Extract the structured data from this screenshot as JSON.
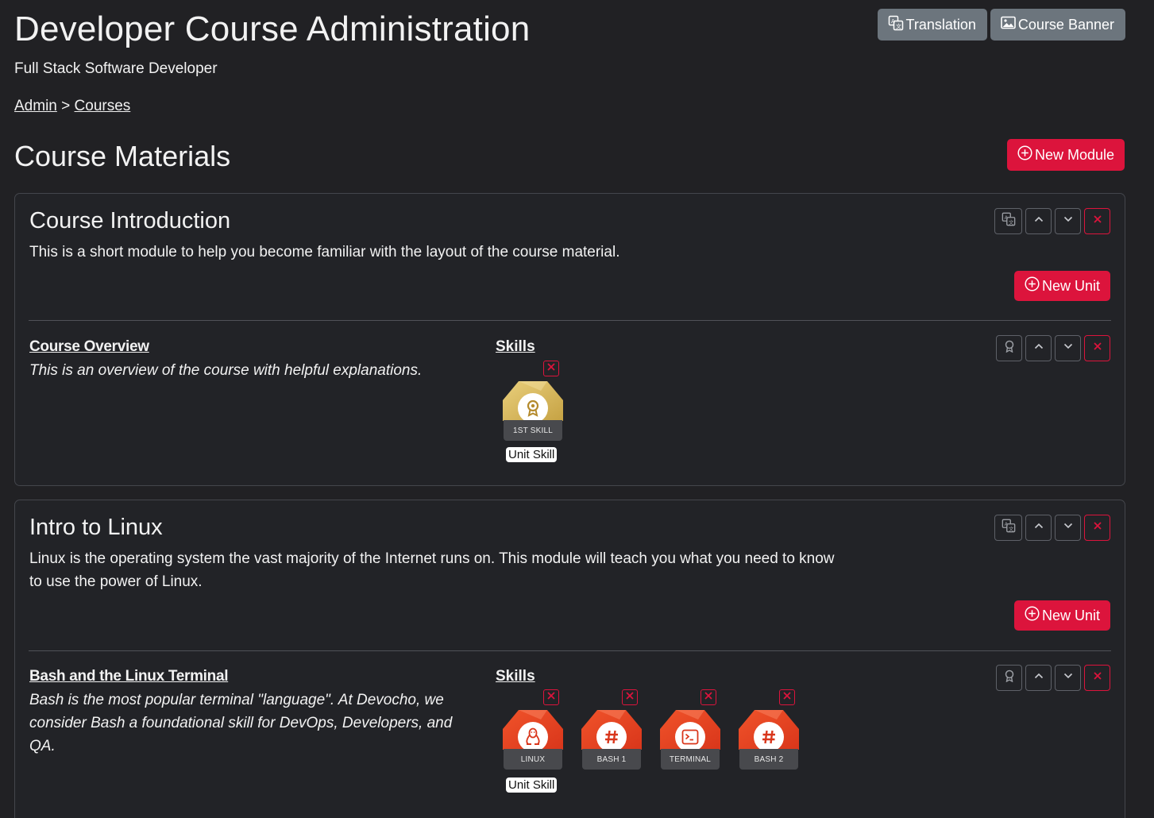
{
  "header": {
    "title": "Developer Course Administration",
    "subtitle": "Full Stack Software Developer",
    "translation_label": "Translation",
    "course_banner_label": "Course Banner"
  },
  "breadcrumb": {
    "admin": "Admin",
    "separator": ">",
    "courses": "Courses"
  },
  "materials": {
    "title": "Course Materials",
    "new_module_label": "New Module",
    "new_unit_label": "New Unit"
  },
  "modules": [
    {
      "title": "Course Introduction",
      "description": "This is a short module to help you become familiar with the layout of the course material.",
      "units": [
        {
          "title": "Course Overview",
          "description": "This is an overview of the course with helpful explanations.",
          "skills_label": "Skills",
          "skills": [
            {
              "name": "1ST SKILL",
              "icon": "award-icon",
              "color": "gold",
              "tag": "Unit Skill"
            }
          ]
        }
      ]
    },
    {
      "title": "Intro to Linux",
      "description": "Linux is the operating system the vast majority of the Internet runs on. This module will teach you what you need to know to use the power of Linux.",
      "units": [
        {
          "title": "Bash and the Linux Terminal",
          "description": "Bash is the most popular terminal \"language\". At Devocho, we consider Bash a foundational skill for DevOps, Developers, and QA.",
          "skills_label": "Skills",
          "skills": [
            {
              "name": "LINUX",
              "icon": "linux-penguin-icon",
              "color": "red",
              "tag": "Unit Skill"
            },
            {
              "name": "BASH 1",
              "icon": "hash-icon",
              "color": "red"
            },
            {
              "name": "TERMINAL",
              "icon": "terminal-icon",
              "color": "red"
            },
            {
              "name": "BASH 2",
              "icon": "hash-icon",
              "color": "red"
            }
          ]
        }
      ]
    }
  ],
  "colors": {
    "background": "#212124",
    "accent": "#dc143c",
    "secondary_button": "#6c757d",
    "gold_badge": "#d8b75a",
    "red_badge": "#e64a1e"
  }
}
